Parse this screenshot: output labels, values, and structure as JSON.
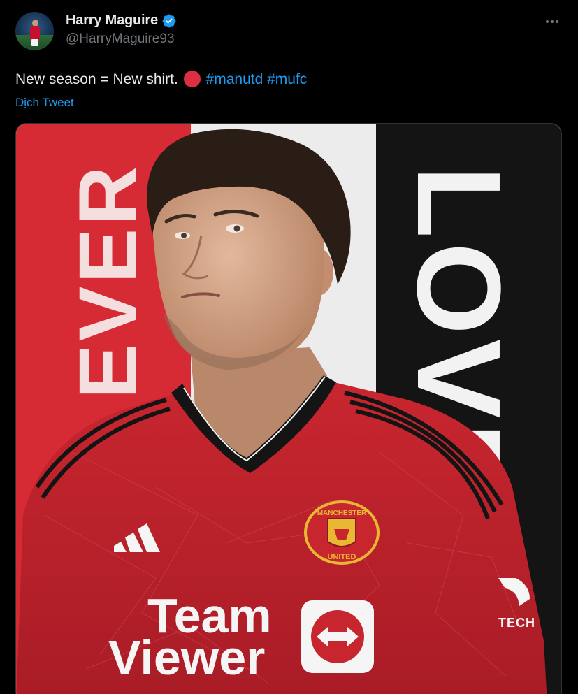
{
  "user": {
    "display_name": "Harry Maguire",
    "handle": "@HarryMaguire93",
    "verified": true
  },
  "tweet": {
    "text_before_emoji": "New season = New shirt.",
    "emoji": "red-circle",
    "hashtags": [
      "#manutd",
      "#mufc"
    ],
    "translate_label": "Dịch Tweet"
  },
  "photo": {
    "banner_left_text": "& EVER",
    "banner_right_text": "LOVE",
    "sponsor_line1": "Team",
    "sponsor_line2": "Viewer",
    "crest_top_text": "MANCHESTER",
    "crest_bottom_text": "UNITED",
    "sleeve_text": "TECH"
  },
  "colors": {
    "accent": "#1d9bf0",
    "background": "#000000",
    "text": "#e7e9ea",
    "muted": "#71767b",
    "shirt_red": "#c0242f",
    "emoji_red": "#dd2e44"
  }
}
